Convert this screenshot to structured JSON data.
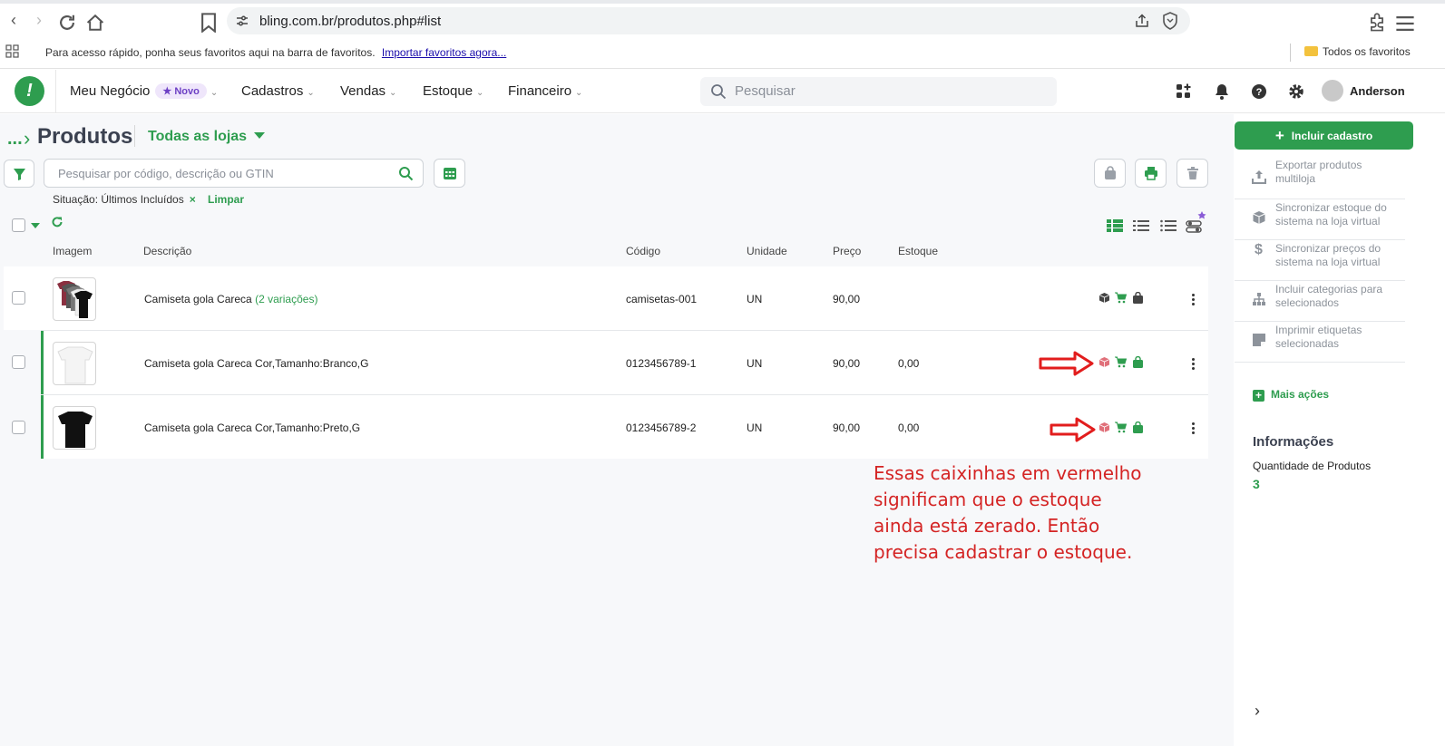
{
  "browser": {
    "url": "bling.com.br/produtos.php#list",
    "bookmarks_hint": "Para acesso rápido, ponha seus favoritos aqui na barra de favoritos.",
    "import_link": "Importar favoritos agora...",
    "all_favorites": "Todos os favoritos"
  },
  "header": {
    "logo_text": "!",
    "menu": [
      {
        "label": "Meu Negócio",
        "badge": "Novo"
      },
      {
        "label": "Cadastros"
      },
      {
        "label": "Vendas"
      },
      {
        "label": "Estoque"
      },
      {
        "label": "Financeiro"
      }
    ],
    "search_placeholder": "Pesquisar",
    "user_name": "Anderson"
  },
  "page": {
    "breadcrumb_dots": "...",
    "title": "Produtos",
    "store_selector": "Todas as lojas",
    "search_placeholder": "Pesquisar por código, descrição ou GTIN",
    "filter_label": "Situação: Últimos Incluídos",
    "filter_clear_x": "×",
    "clear_label": "Limpar"
  },
  "table": {
    "columns": [
      "Imagem",
      "Descrição",
      "Código",
      "Unidade",
      "Preço",
      "Estoque"
    ],
    "rows": [
      {
        "description": "Camiseta gola Careca",
        "variations": "(2 variações)",
        "code": "camisetas-001",
        "unit": "UN",
        "price": "90,00",
        "stock": ""
      },
      {
        "description": "Camiseta gola Careca Cor,Tamanho:Branco,G",
        "variations": "",
        "code": "0123456789-1",
        "unit": "UN",
        "price": "90,00",
        "stock": "0,00"
      },
      {
        "description": "Camiseta gola Careca Cor,Tamanho:Preto,G",
        "variations": "",
        "code": "0123456789-2",
        "unit": "UN",
        "price": "90,00",
        "stock": "0,00"
      }
    ]
  },
  "annotation": {
    "text": "Essas caixinhas em vermelho significam que o estoque ainda está zerado. Então precisa cadastrar o estoque."
  },
  "sidebar": {
    "include_button": "Incluir cadastro",
    "actions": [
      "Exportar produtos multiloja",
      "Sincronizar estoque do sistema na loja virtual",
      "Sincronizar preços do sistema na loja virtual",
      "Incluir categorias para selecionados",
      "Imprimir etiquetas selecionadas"
    ],
    "more_actions": "Mais ações",
    "info_title": "Informações",
    "product_count_label": "Quantidade de Produtos",
    "product_count": "3"
  },
  "colors": {
    "brand_green": "#2e9d4f",
    "alert_red": "#d42424",
    "purple_badge": "#6c3fc4"
  }
}
